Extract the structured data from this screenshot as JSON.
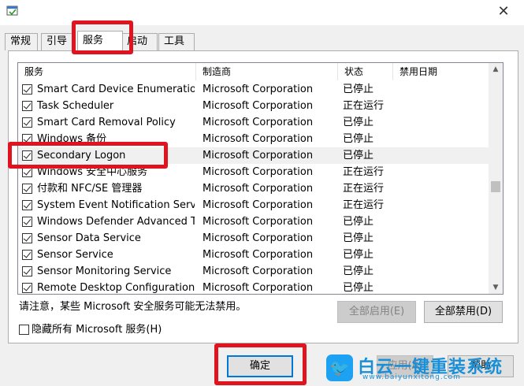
{
  "window": {
    "close_glyph": "✕"
  },
  "tabs": [
    {
      "label": "常规"
    },
    {
      "label": "引导"
    },
    {
      "label": "服务"
    },
    {
      "label": "启动"
    },
    {
      "label": "工具"
    }
  ],
  "services": {
    "columns": [
      "服务",
      "制造商",
      "状态",
      "禁用日期"
    ],
    "rows": [
      {
        "name": "Smart Card Device Enumeration ...",
        "manufacturer": "Microsoft Corporation",
        "status": "已停止",
        "checked": true
      },
      {
        "name": "Task Scheduler",
        "manufacturer": "Microsoft Corporation",
        "status": "正在运行",
        "checked": true
      },
      {
        "name": "Smart Card Removal Policy",
        "manufacturer": "Microsoft Corporation",
        "status": "已停止",
        "checked": true
      },
      {
        "name": "Windows 备份",
        "manufacturer": "Microsoft Corporation",
        "status": "已停止",
        "checked": true
      },
      {
        "name": "Secondary Logon",
        "manufacturer": "Microsoft Corporation",
        "status": "已停止",
        "checked": true
      },
      {
        "name": "Windows 安全中心服务",
        "manufacturer": "Microsoft Corporation",
        "status": "正在运行",
        "checked": true
      },
      {
        "name": "付款和 NFC/SE 管理器",
        "manufacturer": "Microsoft Corporation",
        "status": "正在运行",
        "checked": true
      },
      {
        "name": "System Event Notification Service",
        "manufacturer": "Microsoft Corporation",
        "status": "正在运行",
        "checked": true
      },
      {
        "name": "Windows Defender Advanced Th...",
        "manufacturer": "Microsoft Corporation",
        "status": "已停止",
        "checked": true
      },
      {
        "name": "Sensor Data Service",
        "manufacturer": "Microsoft Corporation",
        "status": "已停止",
        "checked": true
      },
      {
        "name": "Sensor Service",
        "manufacturer": "Microsoft Corporation",
        "status": "已停止",
        "checked": true
      },
      {
        "name": "Sensor Monitoring Service",
        "manufacturer": "Microsoft Corporation",
        "status": "已停止",
        "checked": true
      },
      {
        "name": "Remote Desktop Configuration",
        "manufacturer": "Microsoft Corporation",
        "status": "已停止",
        "checked": true
      }
    ]
  },
  "note": "请注意，某些 Microsoft 安全服务可能无法禁用。",
  "buttons": {
    "enable_all": "全部启用(E)",
    "disable_all": "全部禁用(D)",
    "ok": "确定",
    "apply": "应用(A)",
    "help": "帮助"
  },
  "hide_ms": {
    "label": "隐藏所有 Microsoft 服务(H)",
    "checked": false
  },
  "watermark": {
    "title": "白云一键重装系统",
    "url": "www.baiyunxitong.com"
  },
  "colors": {
    "annotation_red": "#e0141e",
    "watermark_blue": "#1a8fd6"
  }
}
